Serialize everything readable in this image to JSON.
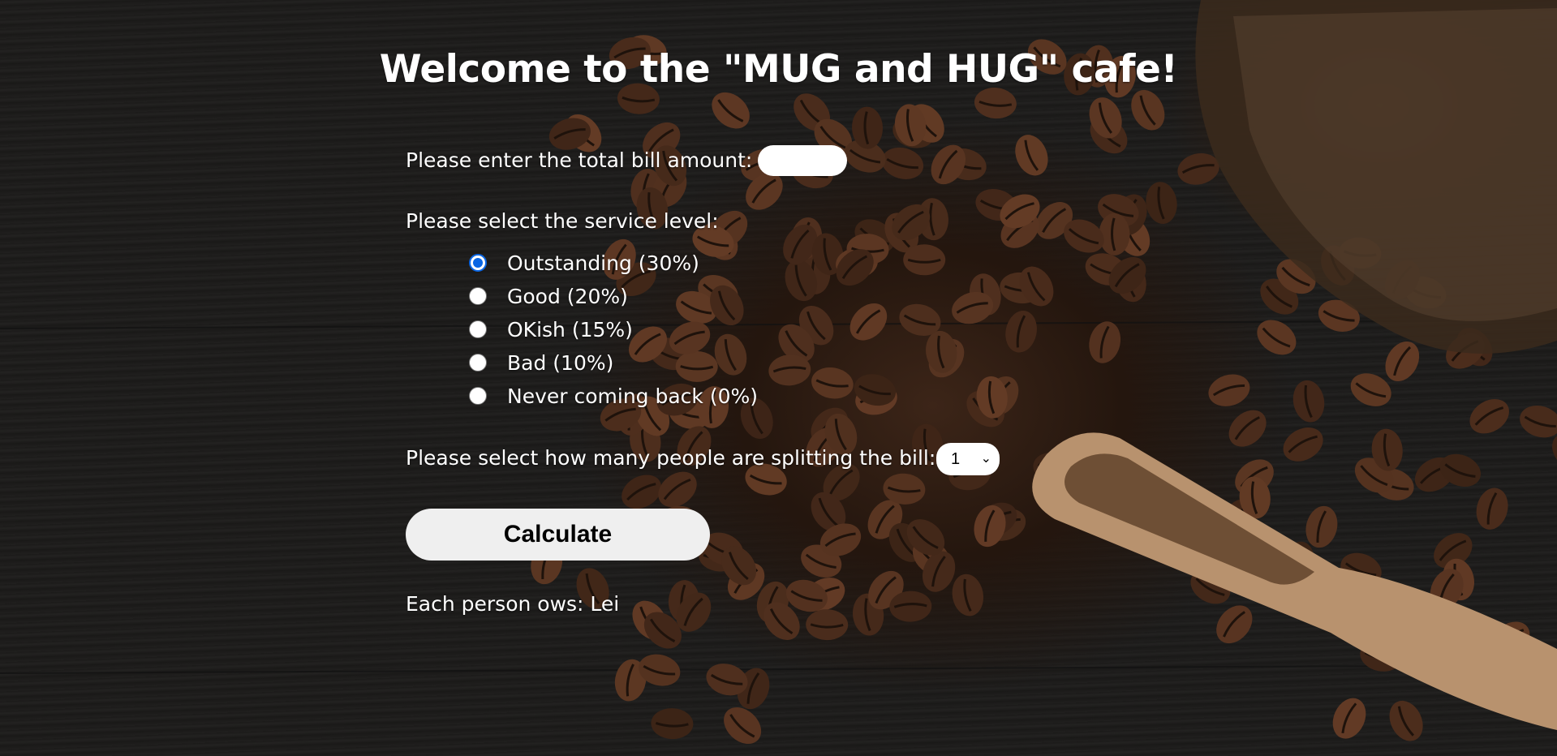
{
  "header": {
    "title": "Welcome to the \"MUG and HUG\" cafe!"
  },
  "bill": {
    "label": "Please enter the total bill amount:",
    "value": ""
  },
  "service": {
    "label": "Please select the service level:",
    "options": [
      {
        "label": "Outstanding (30%)",
        "checked": true
      },
      {
        "label": "Good (20%)",
        "checked": false
      },
      {
        "label": "OKish (15%)",
        "checked": false
      },
      {
        "label": "Bad (10%)",
        "checked": false
      },
      {
        "label": "Never coming back (0%)",
        "checked": false
      }
    ]
  },
  "split": {
    "label": "Please select how many people are splitting the bill:",
    "selected": "1"
  },
  "actions": {
    "calculate_label": "Calculate"
  },
  "result": {
    "text": "Each person ows: Lei"
  },
  "colors": {
    "accent": "#0a66e4",
    "button_bg": "#efefef",
    "background": "#1a1918"
  }
}
